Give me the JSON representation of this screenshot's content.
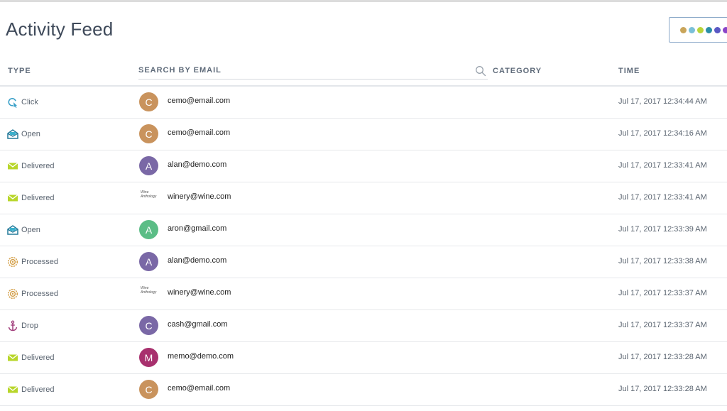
{
  "page": {
    "title": "Activity Feed"
  },
  "loader": {
    "dots": [
      "#c9a55a",
      "#7ac0d8",
      "#b9d43a",
      "#2a8ea8",
      "#5a58c4",
      "#8a44c8"
    ]
  },
  "columns": {
    "type": "TYPE",
    "search_placeholder": "SEARCH BY EMAIL",
    "category": "CATEGORY",
    "time": "TIME"
  },
  "rows": [
    {
      "type": "Click",
      "type_icon": "click-icon",
      "avatar_letter": "C",
      "avatar_color": "#c9935d",
      "email": "cemo@email.com",
      "category": "",
      "time": "Jul 17, 2017 12:34:44 AM"
    },
    {
      "type": "Open",
      "type_icon": "open-envelope-icon",
      "avatar_letter": "C",
      "avatar_color": "#c9935d",
      "email": "cemo@email.com",
      "category": "",
      "time": "Jul 17, 2017 12:34:16 AM"
    },
    {
      "type": "Delivered",
      "type_icon": "delivered-envelope-icon",
      "avatar_letter": "A",
      "avatar_color": "#7a68a6",
      "email": "alan@demo.com",
      "category": "",
      "time": "Jul 17, 2017 12:33:41 AM"
    },
    {
      "type": "Delivered",
      "type_icon": "delivered-envelope-icon",
      "avatar_letter": "",
      "avatar_image": "Wine Anthology",
      "avatar_color": "#ffffff",
      "email": "winery@wine.com",
      "category": "",
      "time": "Jul 17, 2017 12:33:41 AM"
    },
    {
      "type": "Open",
      "type_icon": "open-envelope-icon",
      "avatar_letter": "A",
      "avatar_color": "#5bbd86",
      "email": "aron@gmail.com",
      "category": "",
      "time": "Jul 17, 2017 12:33:39 AM"
    },
    {
      "type": "Processed",
      "type_icon": "processed-gear-icon",
      "avatar_letter": "A",
      "avatar_color": "#7a68a6",
      "email": "alan@demo.com",
      "category": "",
      "time": "Jul 17, 2017 12:33:38 AM"
    },
    {
      "type": "Processed",
      "type_icon": "processed-gear-icon",
      "avatar_letter": "",
      "avatar_image": "Wine Anthology",
      "avatar_color": "#ffffff",
      "email": "winery@wine.com",
      "category": "",
      "time": "Jul 17, 2017 12:33:37 AM"
    },
    {
      "type": "Drop",
      "type_icon": "anchor-icon",
      "avatar_letter": "C",
      "avatar_color": "#7a68a6",
      "email": "cash@gmail.com",
      "category": "",
      "time": "Jul 17, 2017 12:33:37 AM"
    },
    {
      "type": "Delivered",
      "type_icon": "delivered-envelope-icon",
      "avatar_letter": "M",
      "avatar_color": "#a8306e",
      "email": "memo@demo.com",
      "category": "",
      "time": "Jul 17, 2017 12:33:28 AM"
    },
    {
      "type": "Delivered",
      "type_icon": "delivered-envelope-icon",
      "avatar_letter": "C",
      "avatar_color": "#c9935d",
      "email": "cemo@email.com",
      "category": "",
      "time": "Jul 17, 2017 12:33:28 AM"
    }
  ]
}
